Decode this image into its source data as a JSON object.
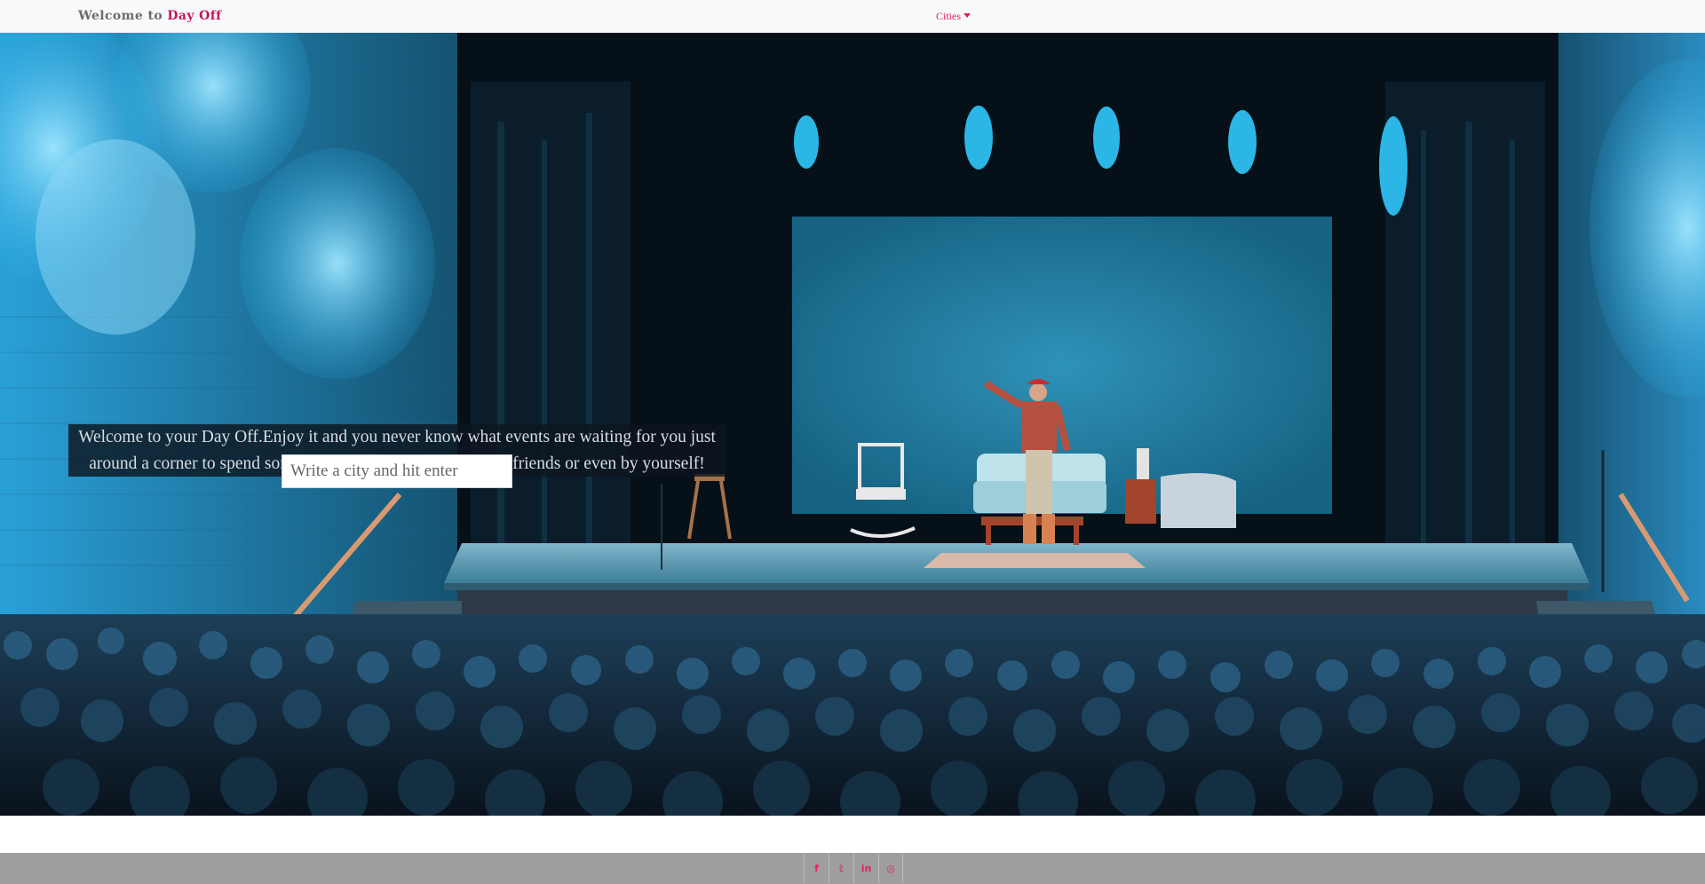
{
  "navbar": {
    "brand_prefix": "Welcome to ",
    "brand_name": "Day Off",
    "cities_label": "Cities"
  },
  "hero": {
    "welcome_text": "Welcome to your Day Off.Enjoy it and you never know what events are waiting for you just around a corner to spend some quality time with your family,friends or even by yourself!",
    "search_placeholder": "Write a city and hit enter"
  },
  "footer": {
    "social": [
      {
        "icon": "facebook-icon",
        "glyph": "f"
      },
      {
        "icon": "twitter-icon",
        "glyph": "𝕥"
      },
      {
        "icon": "linkedin-icon",
        "glyph": "in"
      },
      {
        "icon": "github-icon",
        "glyph": "◎"
      }
    ]
  },
  "colors": {
    "accent": "#e91e63",
    "navbar_bg": "#f8f9fa",
    "footer_bg": "#9e9e9e"
  }
}
